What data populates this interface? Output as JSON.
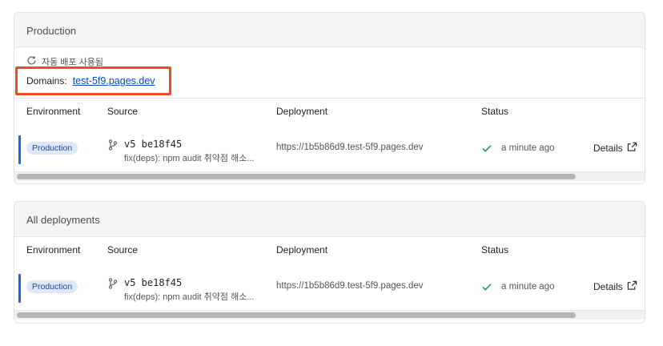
{
  "production": {
    "title": "Production",
    "auto_deploy": "자동 배포 사용됨",
    "domains_label": "Domains:",
    "domain": "test-5f9.pages.dev"
  },
  "all_deployments": {
    "title": "All deployments"
  },
  "table_headers": {
    "environment": "Environment",
    "source": "Source",
    "deployment": "Deployment",
    "status": "Status"
  },
  "rows": [
    {
      "environment": "Production",
      "commit_version": "v5 be18f45",
      "commit_message": "fix(deps): npm audit 취약점 해소...",
      "deployment_url": "https://1b5b86d9.test-5f9.pages.dev",
      "status": "a minute ago",
      "details": "Details"
    },
    {
      "environment": "Production",
      "commit_version": "v5 be18f45",
      "commit_message": "fix(deps): npm audit 취약점 해소...",
      "deployment_url": "https://1b5b86d9.test-5f9.pages.dev",
      "status": "a minute ago",
      "details": "Details"
    }
  ],
  "colors": {
    "accent": "#1a66e8",
    "badge_bg": "#dde8fb",
    "highlight": "#ef4b25",
    "success": "#1e9e4a"
  },
  "icons": [
    "refresh-icon",
    "git-branch-icon",
    "check-icon",
    "external-link-icon"
  ]
}
